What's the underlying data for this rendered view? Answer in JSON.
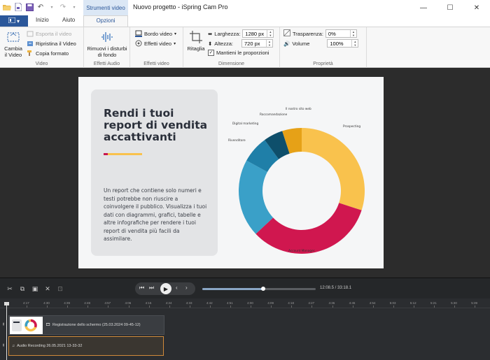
{
  "app": {
    "title": "Nuovo progetto - iSpring Cam Pro",
    "context_tab_header": "Strumenti video",
    "window_controls": [
      "minimize-icon",
      "maximize-icon",
      "close-icon"
    ]
  },
  "tabs": {
    "file_icon": "menu-icon",
    "items": [
      {
        "label": "Inizio",
        "active": false
      },
      {
        "label": "Aiuto",
        "active": false
      },
      {
        "label": "Opzioni",
        "active": true
      }
    ]
  },
  "ribbon": {
    "groups": {
      "video": {
        "label": "Video",
        "change_video": "Cambia il Video",
        "export_video": "Esporta il video",
        "restore_video": "Ripristina il Video",
        "copy_format": "Copia formato"
      },
      "audio_effects": {
        "label": "Effetti Audio",
        "remove_noise": "Rimuovi i disturbi di fondo"
      },
      "video_effects": {
        "label": "Effetti video",
        "border": "Bordo video",
        "effects": "Effetti video"
      },
      "dimension": {
        "label": "Dimensione",
        "crop": "Ritaglia",
        "width_label": "Larghezza:",
        "width_value": "1280 px",
        "height_label": "Altezza:",
        "height_value": "720 px",
        "keep_ratio": "Mantieni le proporzioni",
        "keep_ratio_checked": true
      },
      "properties": {
        "label": "Proprietà",
        "transparency_label": "Trasparenza:",
        "transparency_value": "0%",
        "volume_label": "Volume",
        "volume_value": "100%"
      }
    }
  },
  "slide": {
    "title": "Rendi i tuoi report di vendita accattivanti",
    "body": "Un report che contiene solo numeri e testi potrebbe non riuscire a coinvolgere il pubblico. Visualizza i tuoi dati con diagrammi, grafici, tabelle e altre infografiche per rendere i tuoi report di vendita più facili da assimilare.",
    "accent_colors": {
      "red": "#c8174f",
      "yellow": "#f9c24d"
    }
  },
  "chart_data": {
    "type": "pie",
    "donut": true,
    "title": "",
    "categories": [
      "Prospecting",
      "Account Manager",
      "Rivenditore",
      "Digital marketing",
      "Raccomandazione",
      "Il nostro sito web"
    ],
    "values": [
      30,
      33,
      20,
      7,
      5,
      5
    ],
    "colors": [
      "#f9c24d",
      "#d0174f",
      "#3aa0c8",
      "#1f7fa8",
      "#0e4f6b",
      "#e6a117"
    ],
    "legend": "labels on slices"
  },
  "timeline": {
    "time_display": "12:08.5 / 33:18.1",
    "progress": 0.54,
    "ruler_ticks": [
      "4:17",
      "4:30",
      "4:39",
      "4:48",
      "4:57",
      "4:06",
      "4:15",
      "4:24",
      "4:33",
      "4:42",
      "4:51",
      "4:00",
      "4:09",
      "4:18",
      "4:27",
      "4:36",
      "4:45",
      "4:54",
      "5:03",
      "5:12",
      "5:21",
      "5:30",
      "5:39",
      "5:48"
    ],
    "video_clip": "Registrazione dello schermo (25.03.2024 09-45-12)",
    "audio_clip": "Audio Recording 26.05.2021 13-33-32"
  }
}
